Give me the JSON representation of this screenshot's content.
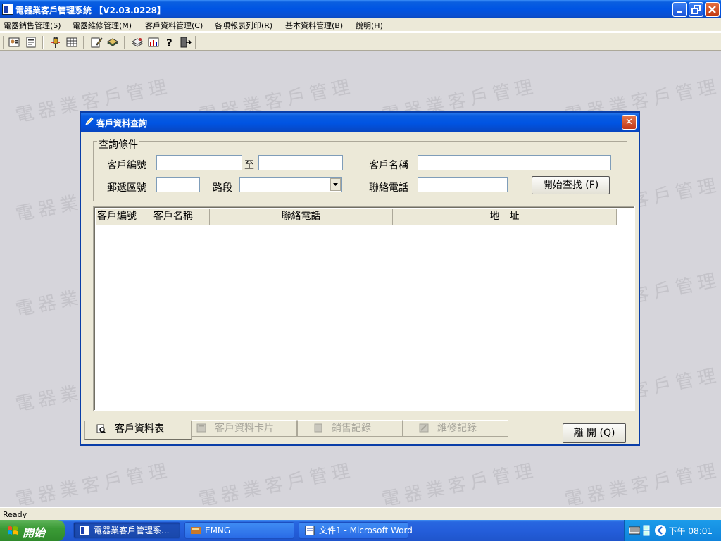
{
  "window": {
    "title": "電器業客戶管理系統 【V2.03.0228】"
  },
  "menu": [
    "電器銷售管理(S)",
    "電器維修管理(M)",
    "客戶資料管理(C)",
    "各項報表列印(R)",
    "基本資料管理(B)",
    "說明(H)"
  ],
  "toolbar_icons": [
    "customer-card-icon",
    "report-icon",
    "plug-icon",
    "table-icon",
    "edit-icon",
    "books-icon",
    "stack-icon",
    "chart-icon",
    "help-icon",
    "exit-icon"
  ],
  "watermark": "電器業客戶管理",
  "dialog": {
    "title": "客戶資料查詢",
    "close": "✕",
    "group_label": "查詢條件",
    "fields": {
      "customer_no_label": "客戶編號",
      "customer_no_from": "",
      "to_label": "至",
      "customer_no_to": "",
      "customer_name_label": "客戶名稱",
      "customer_name": "",
      "zip_label": "郵遞區號",
      "zip": "",
      "road_label": "路段",
      "road": "",
      "phone_label": "聯絡電話",
      "phone": ""
    },
    "search_button": "開始查找 (F)",
    "grid": {
      "columns": [
        "客戶編號",
        "客戶名稱",
        "聯絡電話",
        "地　址"
      ],
      "rows": []
    },
    "tabs": [
      {
        "label": "客戶資料表",
        "active": true,
        "enabled": true
      },
      {
        "label": "客戶資料卡片",
        "active": false,
        "enabled": false
      },
      {
        "label": "銷售記錄",
        "active": false,
        "enabled": false
      },
      {
        "label": "維修記錄",
        "active": false,
        "enabled": false
      }
    ],
    "leave_button": "離 開 (Q)"
  },
  "status": {
    "text": "Ready"
  },
  "taskbar": {
    "start": "開始",
    "tasks": [
      {
        "label": "電器業客戶管理系...",
        "active": true
      },
      {
        "label": "EMNG",
        "active": false
      },
      {
        "label": "文件1 - Microsoft Word",
        "active": false
      }
    ],
    "clock": "下午 08:01"
  }
}
